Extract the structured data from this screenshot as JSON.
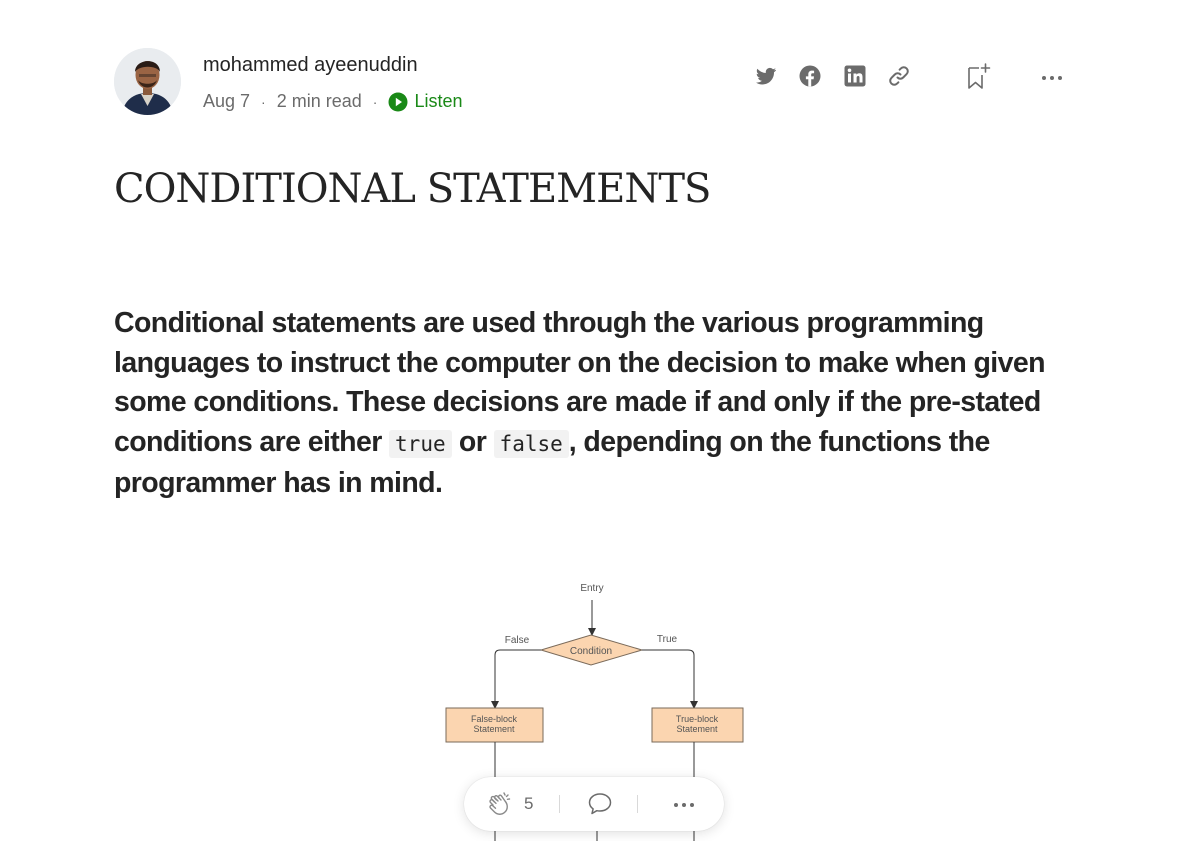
{
  "author": {
    "name": "mohammed ayeenuddin",
    "date": "Aug 7",
    "read_time": "2 min read",
    "listen_label": "Listen"
  },
  "share_icons": [
    "twitter-icon",
    "facebook-icon",
    "linkedin-icon",
    "link-icon",
    "bookmark-add-icon",
    "more-icon"
  ],
  "article": {
    "title": "CONDITIONAL STATEMENTS",
    "lead_part1": "Conditional statements are used through the various programming languages to instruct the computer on the decision to make when given some conditions. These decisions are made if and only if the pre-stated conditions are either ",
    "code_true": "true",
    "lead_or": " or ",
    "code_false": "false",
    "lead_part2": ", depending on the functions the programmer has in mind."
  },
  "diagram": {
    "entry": "Entry",
    "condition": "Condition",
    "false_label": "False",
    "true_label": "True",
    "false_block_line1": "False-block",
    "false_block_line2": "Statement",
    "true_block_line1": "True-block",
    "true_block_line2": "Statement"
  },
  "actions": {
    "clap_count": "5"
  },
  "colors": {
    "accent_green": "#1a8917",
    "text": "#242424",
    "muted": "#6b6b6b",
    "flow_fill": "#fbd5b0"
  }
}
